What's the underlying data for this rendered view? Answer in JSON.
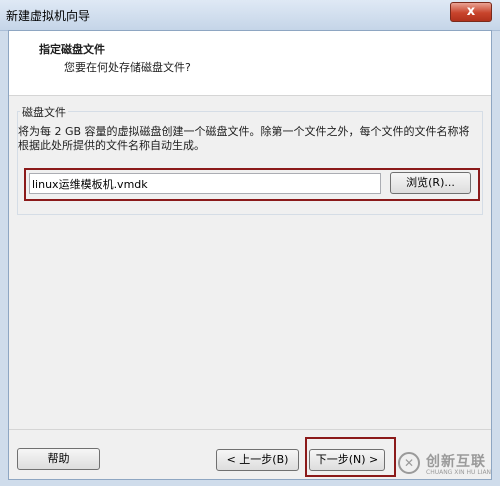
{
  "window": {
    "title": "新建虚拟机向导",
    "close_label": "x"
  },
  "header": {
    "title": "指定磁盘文件",
    "subtitle": "您要在何处存储磁盘文件?"
  },
  "disk_file": {
    "group_label": "磁盘文件",
    "description": "将为每 2 GB 容量的虚拟磁盘创建一个磁盘文件。除第一个文件之外，每个文件的文件名称将根据此处所提供的文件名称自动生成。",
    "filename_value": "linux运维模板机.vmdk",
    "browse_label": "浏览(R)..."
  },
  "footer": {
    "help_label": "帮助",
    "back_label": "< 上一步(B)",
    "next_label": "下一步(N) >"
  },
  "watermark": {
    "icon_glyph": "✕",
    "main_text": "创新互联",
    "sub_text": "CHUANG XIN HU LIAN"
  }
}
